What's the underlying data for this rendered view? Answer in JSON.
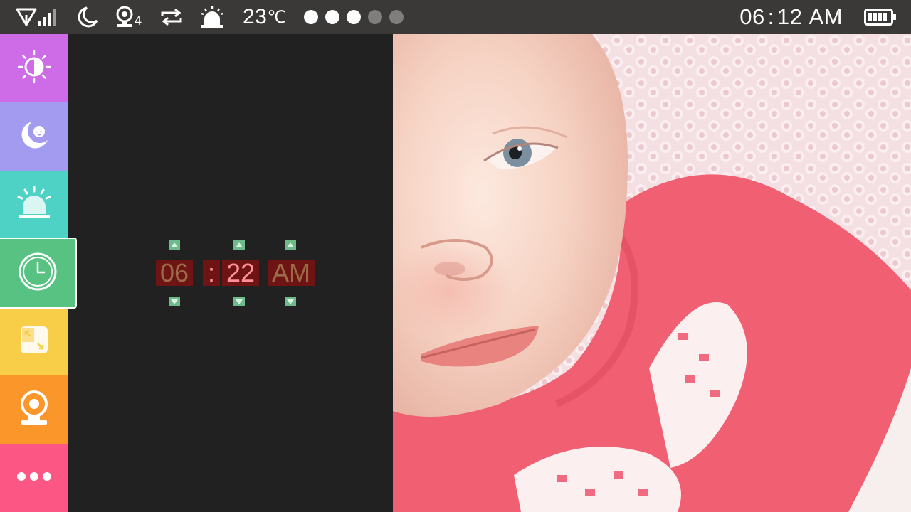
{
  "statusbar": {
    "signal_icon": "wifi-signal-icon",
    "night_icon": "moon-icon",
    "camera_icon": "camera-icon",
    "camera_count": "4",
    "repeat_icon": "repeat-icon",
    "alarm_icon": "alarm-siren-icon",
    "temperature_value": "23",
    "temperature_unit": "℃",
    "page_dots": {
      "total": 5,
      "active": 3,
      "active_color": "#ffffff",
      "inactive_color": "#7f7e7d"
    },
    "clock": {
      "hour": "06",
      "separator": ":",
      "minute": "12",
      "period": "AM"
    },
    "battery_icon": "battery-icon"
  },
  "sidebar": {
    "items": [
      {
        "id": "brightness",
        "icon": "brightness-icon",
        "color": "#cd6ce6"
      },
      {
        "id": "night-mode",
        "icon": "sleeping-baby-moon-icon",
        "color": "#a39bf0"
      },
      {
        "id": "alarm",
        "icon": "alarm-siren-icon",
        "color": "#4ed2c6"
      },
      {
        "id": "clock",
        "icon": "clock-icon",
        "color": "#58c283",
        "active": true
      },
      {
        "id": "resize",
        "icon": "resize-icon",
        "color": "#f8cd48"
      },
      {
        "id": "camera",
        "icon": "camera-icon",
        "color": "#fb962a"
      },
      {
        "id": "more",
        "icon": "more-dots-icon",
        "color": "#fb5684"
      }
    ]
  },
  "time_picker": {
    "hour": "06",
    "separator": ":",
    "minute": "22",
    "period": "AM",
    "digit_color": "#9d6a46",
    "selected_digit_color": "#ff8f9a",
    "digit_background": "#6e1414",
    "button_color": "#6fba8a"
  },
  "photo": {
    "description_icon": "baby-photo"
  }
}
